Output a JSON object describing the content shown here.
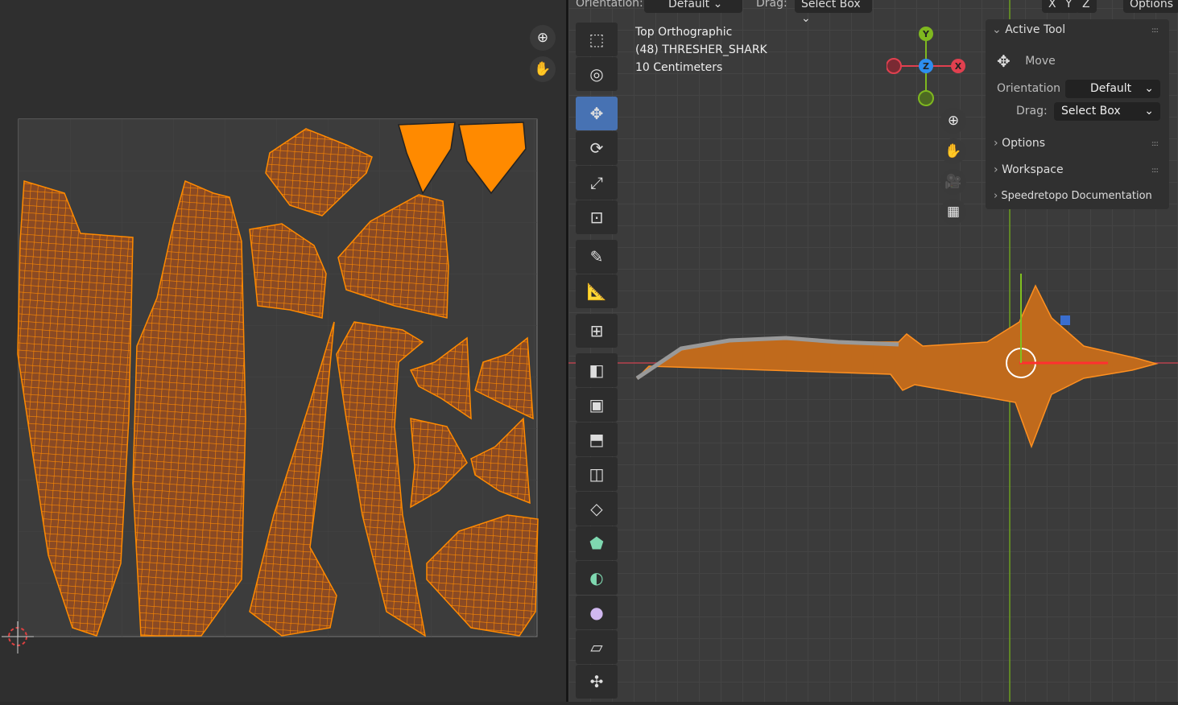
{
  "header": {
    "orientation_label": "Orientation:",
    "orientation_value": "Default",
    "drag_label": "Drag:",
    "drag_value": "Select Box",
    "axes": [
      "X",
      "Y",
      "Z"
    ],
    "options_label": "Options"
  },
  "viewport_info": {
    "view": "Top Orthographic",
    "object": "(48) THRESHER_SHARK",
    "scale": "10 Centimeters"
  },
  "gizmo": {
    "y": "Y",
    "z": "Z",
    "x": "X"
  },
  "npanel": {
    "active_tool": "Active Tool",
    "tool_name": "Move",
    "orientation_label": "Orientation",
    "orientation_value": "Default",
    "drag_label": "Drag:",
    "drag_value": "Select Box",
    "sections": [
      "Options",
      "Workspace",
      "Speedretopo Documentation"
    ]
  },
  "colors": {
    "uv_fill": "#8a4a24",
    "uv_edge": "#ff8a00",
    "active_tool": "#4772b3",
    "axis_x": "#e0404f",
    "axis_y": "#7fb81f",
    "axis_z": "#2d8ef0"
  }
}
